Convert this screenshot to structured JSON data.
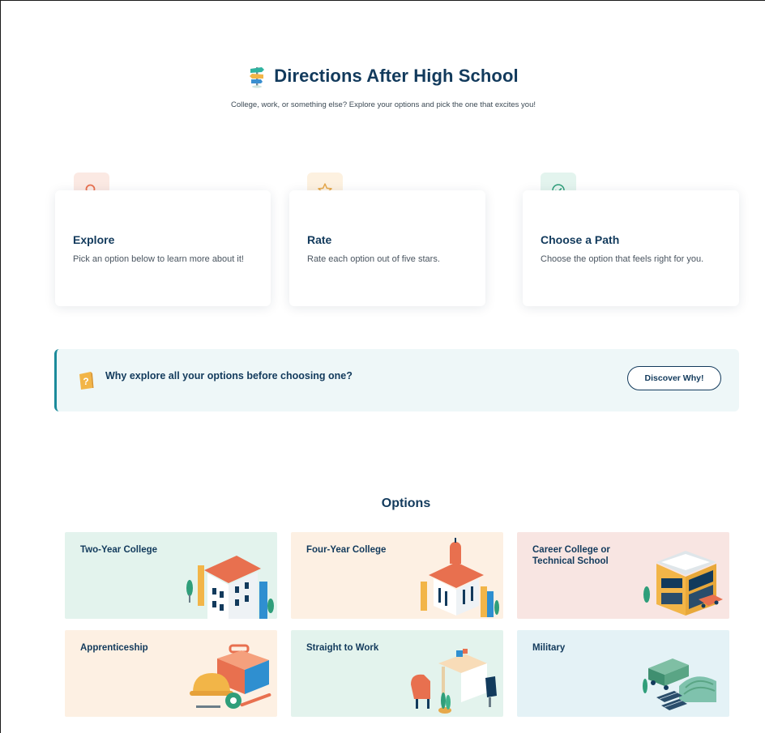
{
  "header": {
    "title": "Directions After High School",
    "subtitle": "College, work, or something else? Explore your options and pick the one that excites you!"
  },
  "steps": [
    {
      "title": "Explore",
      "description": "Pick an option below to learn more about it!",
      "icon": "search-icon",
      "accent": "#e8704f",
      "tint": "#fbe9e3"
    },
    {
      "title": "Rate",
      "description": "Rate each option out of five stars.",
      "icon": "star-icon",
      "accent": "#e6a84a",
      "tint": "#fdf1e0"
    },
    {
      "title": "Choose a Path",
      "description": "Choose the option that feels right for you.",
      "icon": "check-circle-icon",
      "accent": "#2f9e7a",
      "tint": "#e3f4ee"
    }
  ],
  "banner": {
    "text": "Why explore all your options before choosing one?",
    "button_label": "Discover Why!",
    "icon": "question-icon"
  },
  "options": {
    "heading": "Options",
    "items": [
      {
        "label": "Two-Year College",
        "bg": "#e3f3ed",
        "art": "college-building-icon"
      },
      {
        "label": "Four-Year College",
        "bg": "#fdf0e3",
        "art": "university-icon"
      },
      {
        "label": "Career College or Technical School",
        "bg": "#f8e5e2",
        "art": "tech-school-icon"
      },
      {
        "label": "Apprenticeship",
        "bg": "#fdf0e3",
        "art": "toolbox-icon"
      },
      {
        "label": "Straight to Work",
        "bg": "#e3f3ed",
        "art": "office-desk-icon"
      },
      {
        "label": "Military",
        "bg": "#e4f2f6",
        "art": "military-base-icon"
      }
    ]
  }
}
